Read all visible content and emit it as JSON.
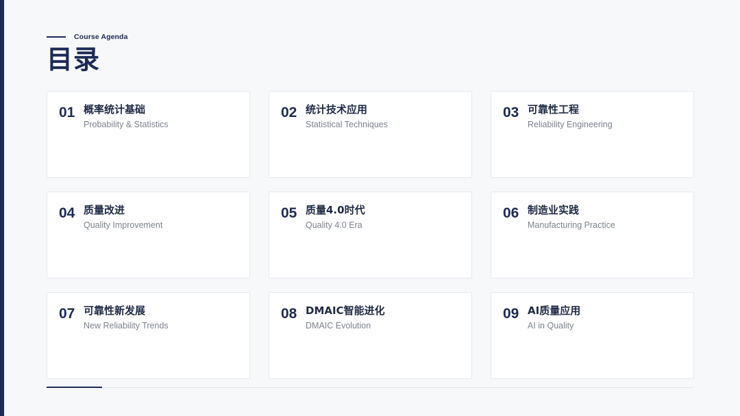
{
  "header": {
    "kicker": "Course Agenda",
    "title": "目录"
  },
  "agenda": {
    "items": [
      {
        "number": "01",
        "title": "概率统计基础",
        "subtitle": "Probability & Statistics"
      },
      {
        "number": "02",
        "title": "统计技术应用",
        "subtitle": "Statistical Techniques"
      },
      {
        "number": "03",
        "title": "可靠性工程",
        "subtitle": "Reliability Engineering"
      },
      {
        "number": "04",
        "title": "质量改进",
        "subtitle": "Quality Improvement"
      },
      {
        "number": "05",
        "title": "质量4.0时代",
        "subtitle": "Quality 4.0 Era"
      },
      {
        "number": "06",
        "title": "制造业实践",
        "subtitle": "Manufacturing Practice"
      },
      {
        "number": "07",
        "title": "可靠性新发展",
        "subtitle": "New Reliability Trends"
      },
      {
        "number": "08",
        "title": "DMAIC智能进化",
        "subtitle": "DMAIC Evolution"
      },
      {
        "number": "09",
        "title": "AI质量应用",
        "subtitle": "AI in Quality"
      }
    ]
  },
  "colors": {
    "primary": "#1c2a55",
    "background": "#f7f8fa",
    "card": "#ffffff",
    "subtitle_text": "#7b818c"
  }
}
